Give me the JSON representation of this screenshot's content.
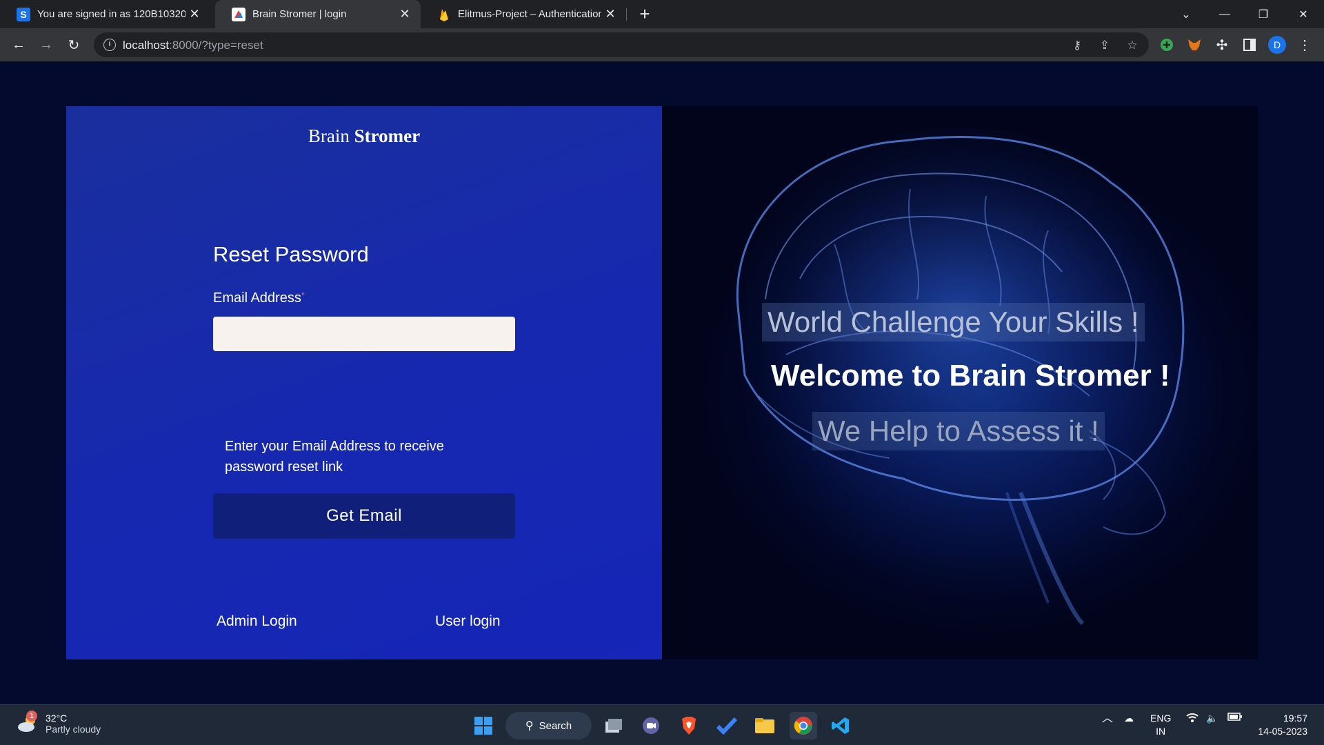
{
  "browser": {
    "tabs": [
      {
        "title": "You are signed in as 120B10320",
        "favicon": "s-icon"
      },
      {
        "title": "Brain Stromer | login",
        "favicon": "brain-icon"
      },
      {
        "title": "Elitmus-Project – Authentication",
        "favicon": "firebase-icon"
      }
    ],
    "url_host": "localhost",
    "url_rest": ":8000/?type=reset",
    "profile_initial": "D"
  },
  "page": {
    "brand_first": "Brain",
    "brand_second": "Stromer",
    "form_title": "Reset Password",
    "email_label": "Email Address",
    "email_required_mark": "*",
    "email_value": "",
    "hint": "Enter your Email Address to receive password reset link",
    "submit_label": "Get Email",
    "admin_link": "Admin Login",
    "user_link": "User login",
    "tagline_1": "World Challenge Your Skills !",
    "tagline_2": "Welcome to Brain Stromer !",
    "tagline_3": "We Help to Assess it !"
  },
  "taskbar": {
    "weather_temp": "32°C",
    "weather_desc": "Partly cloudy",
    "weather_badge": "1",
    "search_label": "Search",
    "lang_top": "ENG",
    "lang_bottom": "IN",
    "time": "19:57",
    "date": "14-05-2023"
  },
  "colors": {
    "left_panel": "#1a2f9d",
    "button": "#0f1f7a",
    "page_bg": "#040a2e"
  }
}
